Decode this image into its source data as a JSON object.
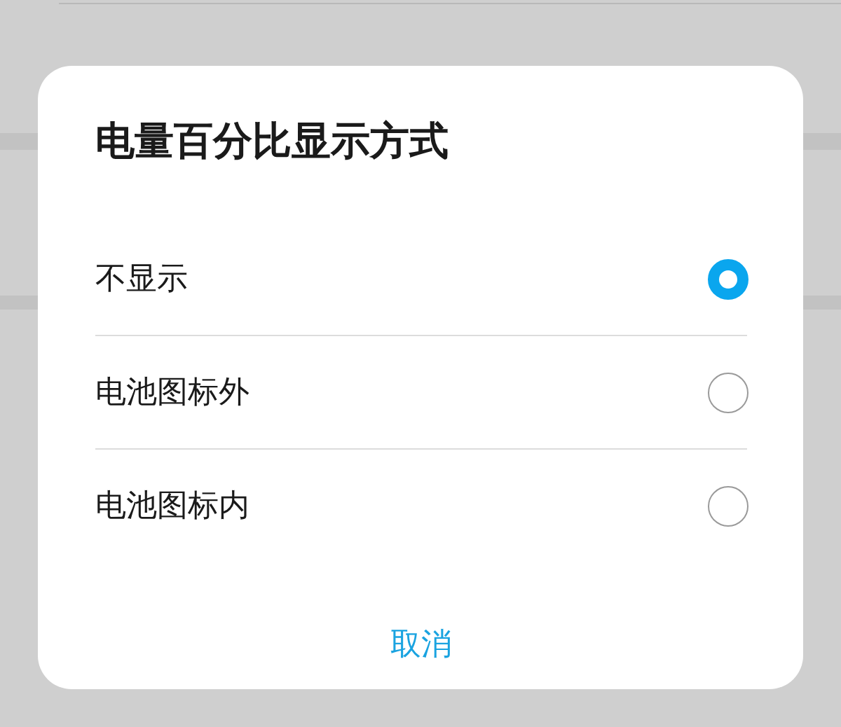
{
  "dialog": {
    "title": "电量百分比显示方式",
    "options": [
      {
        "label": "不显示",
        "selected": true
      },
      {
        "label": "电池图标外",
        "selected": false
      },
      {
        "label": "电池图标内",
        "selected": false
      }
    ],
    "cancel": "取消"
  }
}
